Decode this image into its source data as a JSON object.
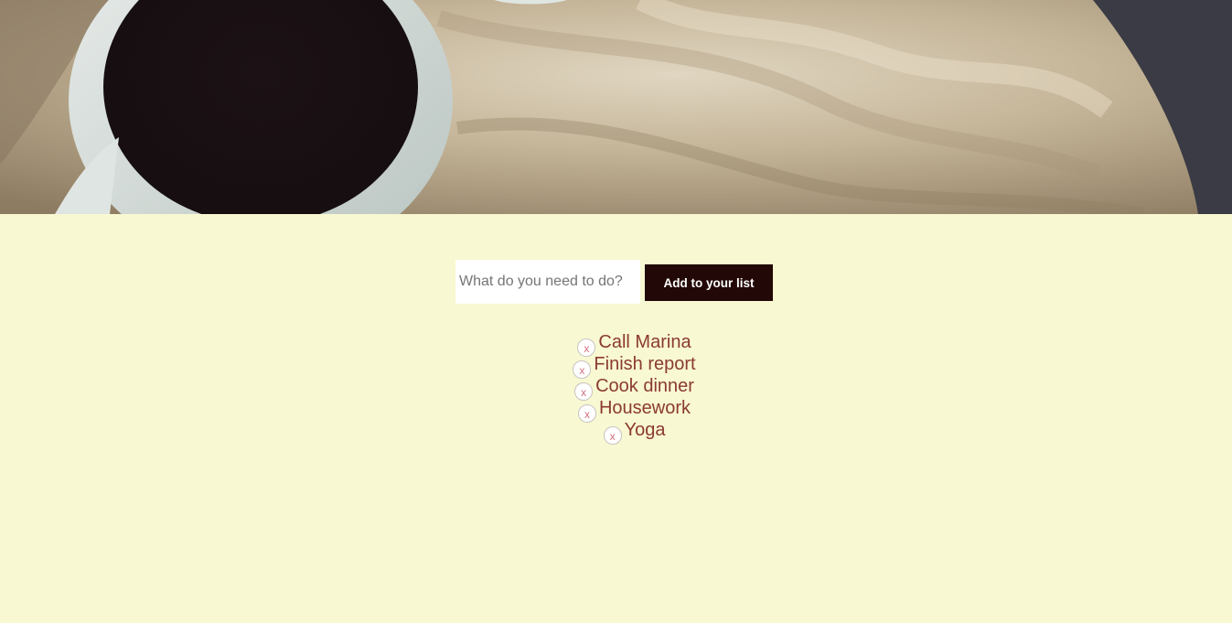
{
  "hero": {
    "image_icon": "coffee-cup-on-wooden-table-image"
  },
  "form": {
    "input_placeholder": "What do you need to do?",
    "input_value": "",
    "add_button_label": "Add to your list"
  },
  "todos": [
    {
      "text": "Call Marina",
      "remove_label": "x"
    },
    {
      "text": "Finish report",
      "remove_label": "x"
    },
    {
      "text": "Cook dinner",
      "remove_label": "x"
    },
    {
      "text": "Housework",
      "remove_label": "x"
    },
    {
      "text": "Yoga",
      "remove_label": "x"
    }
  ],
  "colors": {
    "page_background": "#f8f8d2",
    "button_background": "#220806",
    "todo_text": "#8b3a32",
    "remove_icon": "#d26f7f"
  }
}
